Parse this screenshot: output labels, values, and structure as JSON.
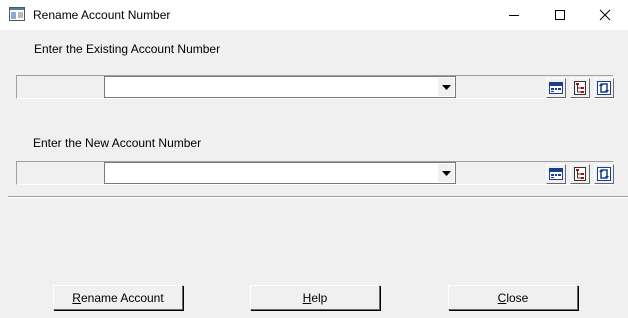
{
  "window": {
    "title": "Rename Account Number",
    "controls": [
      "minimize",
      "maximize",
      "close"
    ]
  },
  "existing": {
    "label": "Enter the Existing Account Number",
    "value": ""
  },
  "new": {
    "label": "Enter the New Account Number",
    "value": ""
  },
  "row_icons": [
    "calendar-list-icon",
    "tree-structure-icon",
    "refresh-icon"
  ],
  "buttons": {
    "rename": {
      "mnemonic": "R",
      "rest": "ename Account"
    },
    "help": {
      "mnemonic": "H",
      "rest": "elp"
    },
    "close": {
      "mnemonic": "C",
      "rest": "lose"
    }
  }
}
